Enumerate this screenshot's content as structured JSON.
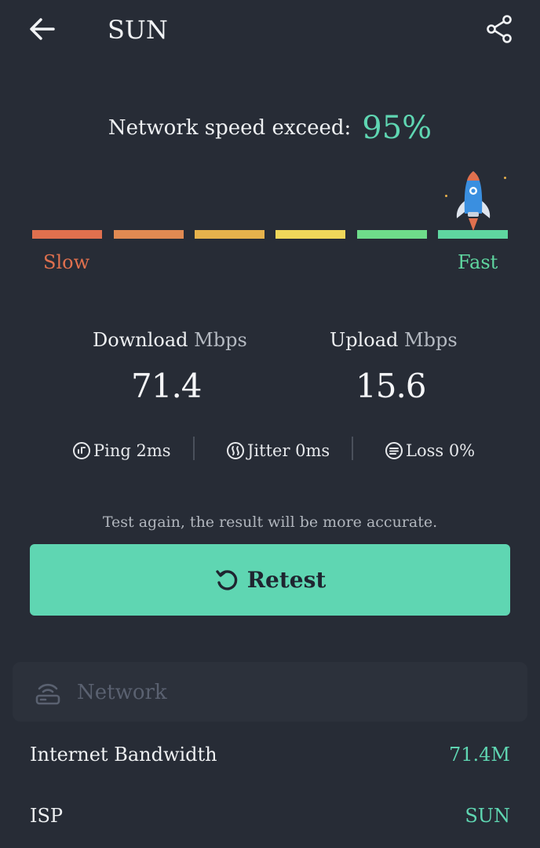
{
  "header": {
    "back_icon": "arrow-left-icon",
    "title": "SUN",
    "share_icon": "share-icon"
  },
  "speed_rating": {
    "label": "Network speed exceed:",
    "value": "95%",
    "slow_label": "Slow",
    "fast_label": "Fast",
    "level_segment": 6,
    "segment_colors": [
      "#e0704e",
      "#e08a52",
      "#e6b24c",
      "#f0d75a",
      "#6fdc8a",
      "#5fd6a0"
    ],
    "indicator_icon": "rocket-icon"
  },
  "results": {
    "download_label": "Download",
    "download_unit": "Mbps",
    "download_value": "71.4",
    "upload_label": "Upload",
    "upload_unit": "Mbps",
    "upload_value": "15.6",
    "ping": "Ping 2ms",
    "jitter": "Jitter 0ms",
    "loss": "Loss 0%"
  },
  "hint": "Test again, the result will be more accurate.",
  "retest": {
    "label": "Retest",
    "icon": "retry-icon"
  },
  "network": {
    "header_label": "Network",
    "header_icon": "router-icon",
    "rows": [
      {
        "label": "Internet Bandwidth",
        "value": "71.4M"
      },
      {
        "label": "ISP",
        "value": "SUN"
      }
    ]
  },
  "colors": {
    "background": "#272c36",
    "accent": "#5fd6b2",
    "slow": "#e0704e"
  }
}
